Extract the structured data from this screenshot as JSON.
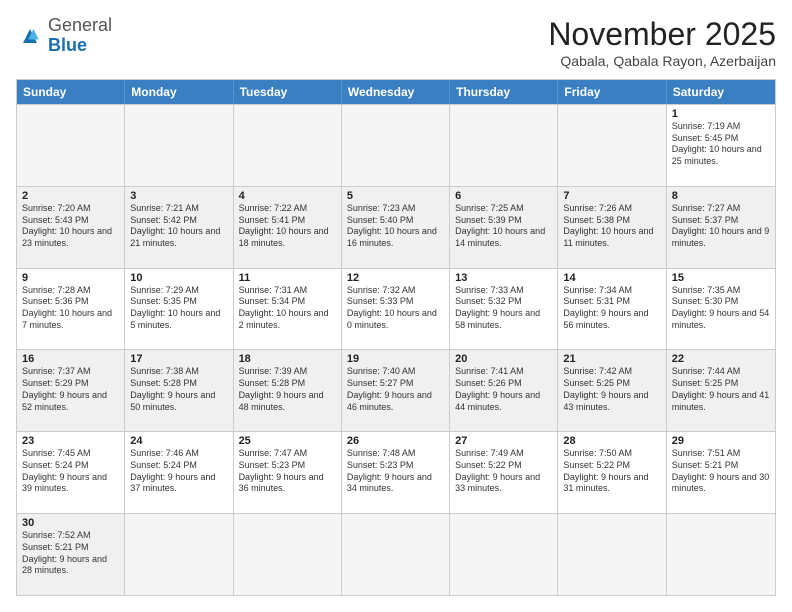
{
  "logo": {
    "general": "General",
    "blue": "Blue"
  },
  "title": "November 2025",
  "subtitle": "Qabala, Qabala Rayon, Azerbaijan",
  "days": [
    "Sunday",
    "Monday",
    "Tuesday",
    "Wednesday",
    "Thursday",
    "Friday",
    "Saturday"
  ],
  "weeks": [
    [
      {
        "day": "",
        "info": "",
        "empty": true
      },
      {
        "day": "",
        "info": "",
        "empty": true
      },
      {
        "day": "",
        "info": "",
        "empty": true
      },
      {
        "day": "",
        "info": "",
        "empty": true
      },
      {
        "day": "",
        "info": "",
        "empty": true
      },
      {
        "day": "",
        "info": "",
        "empty": true
      },
      {
        "day": "1",
        "info": "Sunrise: 7:19 AM\nSunset: 5:45 PM\nDaylight: 10 hours and 25 minutes."
      }
    ],
    [
      {
        "day": "2",
        "info": "Sunrise: 7:20 AM\nSunset: 5:43 PM\nDaylight: 10 hours and 23 minutes."
      },
      {
        "day": "3",
        "info": "Sunrise: 7:21 AM\nSunset: 5:42 PM\nDaylight: 10 hours and 21 minutes."
      },
      {
        "day": "4",
        "info": "Sunrise: 7:22 AM\nSunset: 5:41 PM\nDaylight: 10 hours and 18 minutes."
      },
      {
        "day": "5",
        "info": "Sunrise: 7:23 AM\nSunset: 5:40 PM\nDaylight: 10 hours and 16 minutes."
      },
      {
        "day": "6",
        "info": "Sunrise: 7:25 AM\nSunset: 5:39 PM\nDaylight: 10 hours and 14 minutes."
      },
      {
        "day": "7",
        "info": "Sunrise: 7:26 AM\nSunset: 5:38 PM\nDaylight: 10 hours and 11 minutes."
      },
      {
        "day": "8",
        "info": "Sunrise: 7:27 AM\nSunset: 5:37 PM\nDaylight: 10 hours and 9 minutes."
      }
    ],
    [
      {
        "day": "9",
        "info": "Sunrise: 7:28 AM\nSunset: 5:36 PM\nDaylight: 10 hours and 7 minutes."
      },
      {
        "day": "10",
        "info": "Sunrise: 7:29 AM\nSunset: 5:35 PM\nDaylight: 10 hours and 5 minutes."
      },
      {
        "day": "11",
        "info": "Sunrise: 7:31 AM\nSunset: 5:34 PM\nDaylight: 10 hours and 2 minutes."
      },
      {
        "day": "12",
        "info": "Sunrise: 7:32 AM\nSunset: 5:33 PM\nDaylight: 10 hours and 0 minutes."
      },
      {
        "day": "13",
        "info": "Sunrise: 7:33 AM\nSunset: 5:32 PM\nDaylight: 9 hours and 58 minutes."
      },
      {
        "day": "14",
        "info": "Sunrise: 7:34 AM\nSunset: 5:31 PM\nDaylight: 9 hours and 56 minutes."
      },
      {
        "day": "15",
        "info": "Sunrise: 7:35 AM\nSunset: 5:30 PM\nDaylight: 9 hours and 54 minutes."
      }
    ],
    [
      {
        "day": "16",
        "info": "Sunrise: 7:37 AM\nSunset: 5:29 PM\nDaylight: 9 hours and 52 minutes."
      },
      {
        "day": "17",
        "info": "Sunrise: 7:38 AM\nSunset: 5:28 PM\nDaylight: 9 hours and 50 minutes."
      },
      {
        "day": "18",
        "info": "Sunrise: 7:39 AM\nSunset: 5:28 PM\nDaylight: 9 hours and 48 minutes."
      },
      {
        "day": "19",
        "info": "Sunrise: 7:40 AM\nSunset: 5:27 PM\nDaylight: 9 hours and 46 minutes."
      },
      {
        "day": "20",
        "info": "Sunrise: 7:41 AM\nSunset: 5:26 PM\nDaylight: 9 hours and 44 minutes."
      },
      {
        "day": "21",
        "info": "Sunrise: 7:42 AM\nSunset: 5:25 PM\nDaylight: 9 hours and 43 minutes."
      },
      {
        "day": "22",
        "info": "Sunrise: 7:44 AM\nSunset: 5:25 PM\nDaylight: 9 hours and 41 minutes."
      }
    ],
    [
      {
        "day": "23",
        "info": "Sunrise: 7:45 AM\nSunset: 5:24 PM\nDaylight: 9 hours and 39 minutes."
      },
      {
        "day": "24",
        "info": "Sunrise: 7:46 AM\nSunset: 5:24 PM\nDaylight: 9 hours and 37 minutes."
      },
      {
        "day": "25",
        "info": "Sunrise: 7:47 AM\nSunset: 5:23 PM\nDaylight: 9 hours and 36 minutes."
      },
      {
        "day": "26",
        "info": "Sunrise: 7:48 AM\nSunset: 5:23 PM\nDaylight: 9 hours and 34 minutes."
      },
      {
        "day": "27",
        "info": "Sunrise: 7:49 AM\nSunset: 5:22 PM\nDaylight: 9 hours and 33 minutes."
      },
      {
        "day": "28",
        "info": "Sunrise: 7:50 AM\nSunset: 5:22 PM\nDaylight: 9 hours and 31 minutes."
      },
      {
        "day": "29",
        "info": "Sunrise: 7:51 AM\nSunset: 5:21 PM\nDaylight: 9 hours and 30 minutes."
      }
    ],
    [
      {
        "day": "30",
        "info": "Sunrise: 7:52 AM\nSunset: 5:21 PM\nDaylight: 9 hours and 28 minutes."
      },
      {
        "day": "",
        "info": "",
        "empty": true
      },
      {
        "day": "",
        "info": "",
        "empty": true
      },
      {
        "day": "",
        "info": "",
        "empty": true
      },
      {
        "day": "",
        "info": "",
        "empty": true
      },
      {
        "day": "",
        "info": "",
        "empty": true
      },
      {
        "day": "",
        "info": "",
        "empty": true
      }
    ]
  ]
}
